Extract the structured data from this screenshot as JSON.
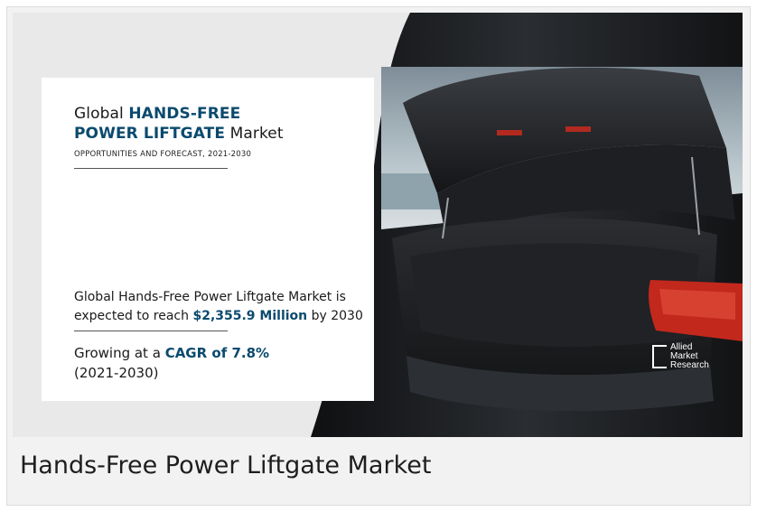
{
  "infographic": {
    "title_prefix": "Global",
    "title_highlight_1": "HANDS-FREE",
    "title_highlight_2": "POWER LIFTGATE",
    "title_suffix": "Market",
    "subtitle": "OPPORTUNITIES AND FORECAST, 2021-2030",
    "stat_line_1": "Global Hands-Free Power Liftgate Market is",
    "stat_prefix": "expected to reach",
    "stat_value": "$2,355.9 Million",
    "stat_suffix": "by 2030",
    "growth_prefix": "Growing at a",
    "growth_value": "CAGR of 7.8%",
    "growth_period": "(2021-2030)"
  },
  "brand": {
    "line1": "Allied",
    "line2": "Market",
    "line3": "Research"
  },
  "caption": "Hands-Free Power Liftgate Market",
  "colors": {
    "accent": "#0b4a6e",
    "car_body": "#1b1d20",
    "tail_light": "#c2281c"
  }
}
